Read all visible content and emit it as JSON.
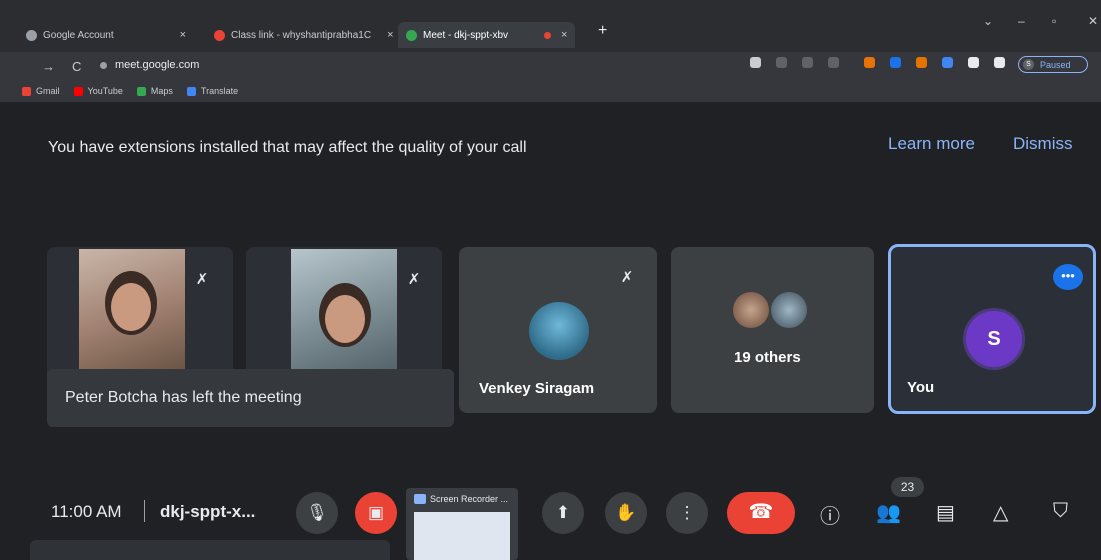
{
  "browser": {
    "tabs": [
      {
        "label": "Google Account",
        "close": "×",
        "color": "#9aa0a6"
      },
      {
        "label": "Class link - whyshantiprabha1C",
        "close": "×",
        "color": "#ea4335"
      },
      {
        "label": "Meet - dkj-sppt-xbv",
        "close": "×",
        "color": "#34a853"
      }
    ],
    "newtab": "+",
    "url": "meet.google.com",
    "profile": {
      "initial": "S",
      "status": "Paused"
    },
    "bookmarks": [
      {
        "label": "Gmail",
        "color": "#ea4335"
      },
      {
        "label": "YouTube",
        "color": "#ff0000"
      },
      {
        "label": "Maps",
        "color": "#34a853"
      },
      {
        "label": "Translate",
        "color": "#4285f4"
      }
    ]
  },
  "meet": {
    "banner_text": "You have extensions installed that may affect the quality of your call",
    "learn_more": "Learn more",
    "dismiss": "Dismiss",
    "toast": "Peter Botcha has left the meeting",
    "tiles": {
      "venkey": "Venkey Siragam",
      "others": "19 others",
      "you": "You",
      "you_initial": "S"
    },
    "time": "11:00 AM",
    "meeting_code": "dkj-sppt-x...",
    "participants_count": "23",
    "recorder_title": "Screen Recorder ..."
  }
}
